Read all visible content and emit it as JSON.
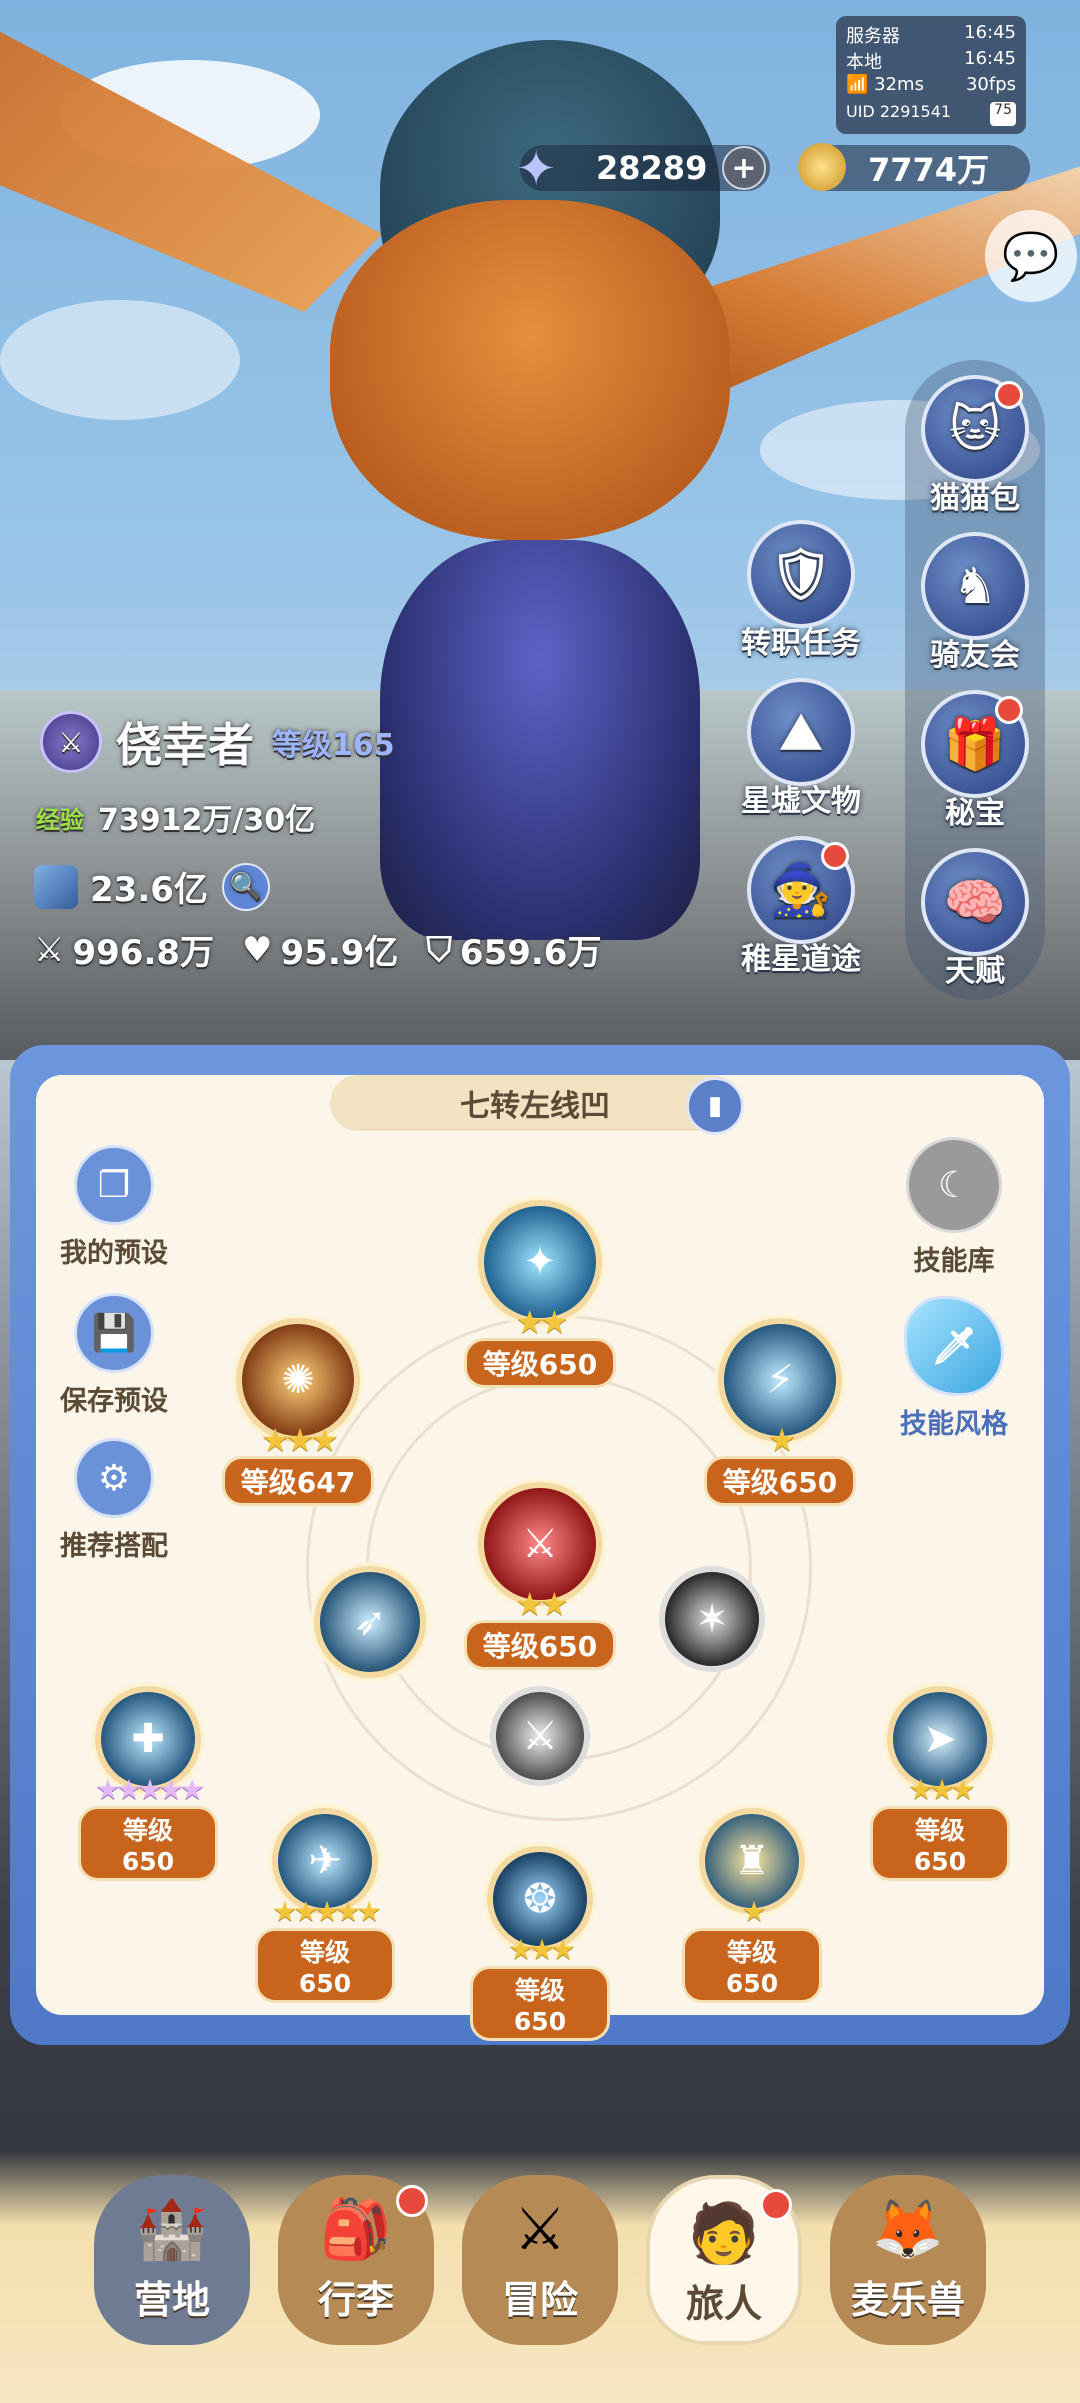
{
  "status": {
    "server_label": "服务器",
    "server_time": "16:45",
    "local_label": "本地",
    "local_time": "16:45",
    "ping": "32ms",
    "fps": "30fps",
    "uid": "UID 2291541",
    "battery": "75"
  },
  "currencies": {
    "stars": "28289",
    "gold": "7774万"
  },
  "side_menu": [
    {
      "label": "猫猫包",
      "icon": "cat-bag-icon",
      "dot": true
    },
    {
      "label": "转职任务",
      "icon": "class-change-icon",
      "dot": false
    },
    {
      "label": "骑友会",
      "icon": "horse-icon",
      "dot": false
    },
    {
      "label": "星墟文物",
      "icon": "ruins-icon",
      "dot": false
    },
    {
      "label": "秘宝",
      "icon": "treasure-icon",
      "dot": true
    },
    {
      "label": "稚星道途",
      "icon": "path-icon",
      "dot": true
    },
    {
      "label": "天赋",
      "icon": "talent-icon",
      "dot": false
    }
  ],
  "player": {
    "name": "侥幸者",
    "level": "等级165",
    "exp_label": "经验",
    "exp": "73912万/30亿",
    "power": "23.6亿",
    "attack": "996.8万",
    "hp": "95.9亿",
    "defense": "659.6万"
  },
  "skill_panel": {
    "plan_name": "七转左线凹",
    "left_buttons": [
      "我的预设",
      "保存预设",
      "推荐搭配"
    ],
    "right_buttons": [
      "技能库",
      "技能风格"
    ],
    "skills": [
      {
        "level": "等级650",
        "stars": 2
      },
      {
        "level": "等级647",
        "stars": 3
      },
      {
        "level": "等级650",
        "stars": 1
      },
      {
        "level": "等级650",
        "stars": 2
      },
      {
        "level": "等级650",
        "stars": 5
      },
      {
        "level": "等级650",
        "stars": 3
      },
      {
        "level": "等级650",
        "stars": 5
      },
      {
        "level": "等级650",
        "stars": 3
      },
      {
        "level": "等级650",
        "stars": 1
      }
    ]
  },
  "nav": [
    {
      "label": "营地",
      "dot": false
    },
    {
      "label": "行李",
      "dot": true
    },
    {
      "label": "冒险",
      "dot": false
    },
    {
      "label": "旅人",
      "dot": true
    },
    {
      "label": "麦乐兽",
      "dot": false
    }
  ]
}
